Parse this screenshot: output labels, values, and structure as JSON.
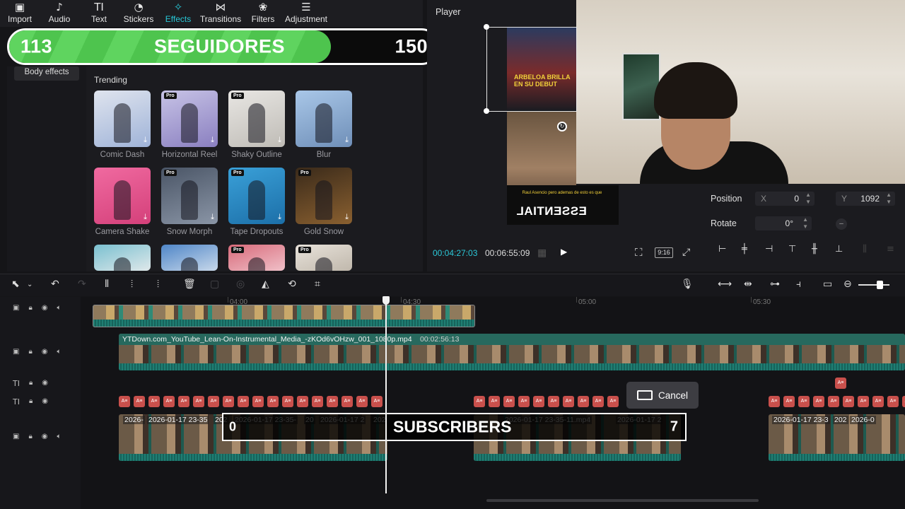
{
  "toolbar": {
    "tabs": [
      {
        "label": "Import",
        "icon": "import-icon",
        "glyph": "▣"
      },
      {
        "label": "Audio",
        "icon": "audio-icon",
        "glyph": "♪"
      },
      {
        "label": "Text",
        "icon": "text-icon",
        "glyph": "TI"
      },
      {
        "label": "Stickers",
        "icon": "sticker-icon",
        "glyph": "◔"
      },
      {
        "label": "Effects",
        "icon": "effects-icon",
        "glyph": "✧"
      },
      {
        "label": "Transitions",
        "icon": "transitions-icon",
        "glyph": "⋈"
      },
      {
        "label": "Filters",
        "icon": "filters-icon",
        "glyph": "❀"
      },
      {
        "label": "Adjustment",
        "icon": "adjustment-icon",
        "glyph": "☰"
      }
    ],
    "active": "Effects",
    "accent": "#27c7d6"
  },
  "followers_overlay": {
    "current": "113",
    "label": "SEGUIDORES",
    "goal": "150",
    "progress": 0.75,
    "fill_color": "#5fd45f"
  },
  "effects": {
    "sidebar_item": "Body effects",
    "section": "Trending",
    "items": [
      {
        "label": "Comic Dash",
        "pro": false,
        "colors": [
          "#dfe4ee",
          "#9fb3d8"
        ]
      },
      {
        "label": "Horizontal Reel",
        "pro": true,
        "colors": [
          "#c7c3e6",
          "#8a7fc0"
        ]
      },
      {
        "label": "Shaky Outline",
        "pro": true,
        "colors": [
          "#e8e6e3",
          "#bfbcb6"
        ]
      },
      {
        "label": "Blur",
        "pro": false,
        "colors": [
          "#a9c7e8",
          "#6f8fb8"
        ]
      },
      {
        "label": "Camera Shake",
        "pro": false,
        "colors": [
          "#f06aa0",
          "#d4407a"
        ]
      },
      {
        "label": "Snow Morph",
        "pro": true,
        "colors": [
          "#4a5566",
          "#8a95a6"
        ]
      },
      {
        "label": "Tape Dropouts",
        "pro": true,
        "colors": [
          "#3aa0d8",
          "#1c6fa8"
        ]
      },
      {
        "label": "Gold Snow",
        "pro": true,
        "colors": [
          "#3a2a1a",
          "#8a6030"
        ]
      },
      {
        "label": "",
        "pro": false,
        "colors": [
          "#7ac0d0",
          "#dfe8ea"
        ]
      },
      {
        "label": "",
        "pro": false,
        "colors": [
          "#4f86c8",
          "#c8d8ea"
        ]
      },
      {
        "label": "",
        "pro": true,
        "colors": [
          "#d86a7a",
          "#f0c0c8"
        ]
      },
      {
        "label": "",
        "pro": true,
        "colors": [
          "#e8e2da",
          "#c0b8ac"
        ]
      }
    ],
    "pro_label": "Pro",
    "download_icon": "download-icon"
  },
  "player": {
    "title": "Player",
    "current_time": "00:04:27:03",
    "total_time": "00:06:55:09",
    "ratio": "9:16",
    "headline": "ARBELOA BRILLA EN SU DEBUT",
    "caption": "Raul Asencio pero ademas de esto es que",
    "mirrored_word": "ESSENTIAL"
  },
  "properties": {
    "position_label": "Position",
    "x_axis": "X",
    "x_value": "0",
    "y_axis": "Y",
    "y_value": "1092",
    "rotate_label": "Rotate",
    "rotate_value": "0°",
    "rotate_dot": "–"
  },
  "timeline": {
    "ruler": [
      "04:00",
      "04:30",
      "05:00",
      "05:30"
    ],
    "clip_name": "YTDown.com_YouTube_Lean-On-Instrumental_Media_-zKOd6vOHzw_001_1080p.mp4",
    "clip_duration": "00:02:56:13",
    "text_chip": "A≡",
    "video_clip_labels": [
      "2026-",
      "2026-01-17 23-35",
      "202",
      "2026-01-17 23-35-",
      "20",
      "2026-01-17 2",
      "202",
      "2026-01-17 23-35-11.mp4",
      "2026-01-17 2",
      "2026-01-17 23-3",
      "202",
      "2026-0"
    ],
    "cancel_label": "Cancel",
    "subscribers": {
      "left": "0",
      "label": "SUBSCRIBERS",
      "right": "7"
    }
  }
}
